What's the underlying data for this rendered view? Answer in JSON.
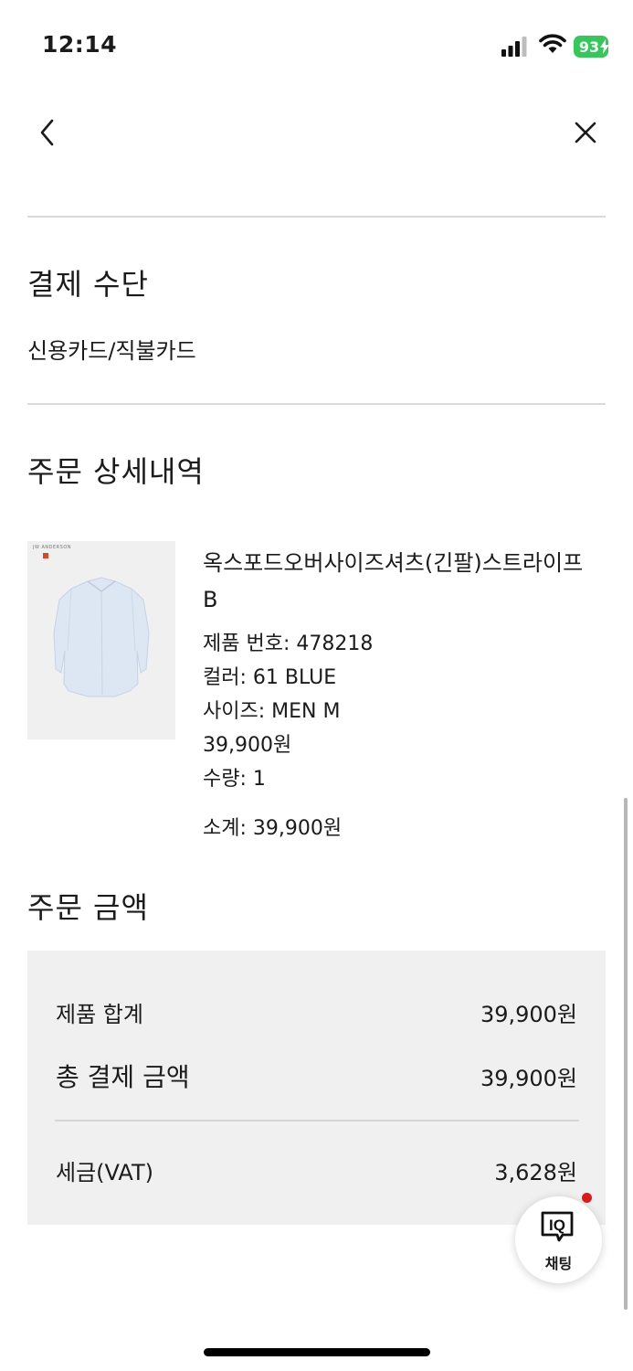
{
  "status_bar": {
    "time": "12:14",
    "battery": "93"
  },
  "payment": {
    "title": "결제 수단",
    "method": "신용카드/직불카드"
  },
  "order_details": {
    "title": "주문 상세내역",
    "product": {
      "thumb_brand": "JW ANDERSON",
      "name": "옥스포드오버사이즈셔츠(긴팔)스트라이프 B",
      "number": "제품 번호: 478218",
      "color": "컬러: 61 BLUE",
      "size": "사이즈: MEN M",
      "price": "39,900원",
      "quantity": "수량: 1",
      "subtotal": "소계: 39,900원"
    }
  },
  "order_amount": {
    "title": "주문 금액",
    "product_total_label": "제품 합계",
    "product_total_value": "39,900원",
    "grand_total_label": "총 결제 금액",
    "grand_total_value": "39,900원",
    "tax_label": "세금(VAT)",
    "tax_value": "3,628원"
  },
  "chat": {
    "icon_text": "IQ",
    "label": "채팅"
  }
}
